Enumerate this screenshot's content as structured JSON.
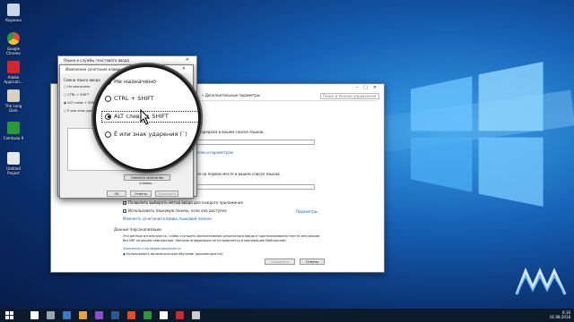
{
  "desktop": {
    "icons": [
      {
        "label": "Корзина",
        "color": "#c9d6e6"
      },
      {
        "label": "Google Chrome",
        "color": "#e8453c"
      },
      {
        "label": "Adobe Applicati...",
        "color": "#d4262c"
      },
      {
        "label": "The Long Dark",
        "color": "#d8d0c0"
      },
      {
        "label": "Camtasia 9",
        "color": "#2a9a3a"
      },
      {
        "label": "Untitled Project",
        "color": "#e8e8e8"
      }
    ]
  },
  "settings_window": {
    "breadcrumb": "« Дополнительные параметры",
    "search_placeholder": "Поиск в панели управления",
    "text1": "...ных интерфейса, которые определен порядком в вашем списке языков.",
    "dropdown1": "...екомендуется)",
    "link1": "...ку просто привязанных учетным записям и параметрам",
    "text2": "...вашем порядке, который находится не на первом месте в вашем списке языков.",
    "dropdown2": "...екомендуется)",
    "checkbox1": "Позволить выбирать метод ввода для каждого приложения",
    "checkbox2": "Использовать языковую панель, если она доступна",
    "link_params": "Параметры",
    "link_hotkeys": "Изменить сочетания клавиш языковой панели",
    "section_personal": "Данные персонализации",
    "personal_text": "Эти данные используются, чтобы улучшить распознавание рукописного ввода и прогнозирования текста для языков без IME на вашем компьютере. Никакая информация не отправляется в корпорацию Майкрософт.",
    "privacy_link": "Заявление о конфиденциальности",
    "auto_learn": "Использовать автоматическое обучение (рекомендуется)",
    "save_button": "Сохранить",
    "cancel_button": "Отмена"
  },
  "lang_dialog": {
    "title": "Языки и службы текстового ввода",
    "inner_title": "Изменение сочетания клавиш",
    "group_label": "Смена языка ввода",
    "options": [
      "Не назначено",
      "CTRL + SHIFT",
      "ALT слева + SHIFT",
      "Ё или знак ударения (`)"
    ],
    "right_group_label": "Смена раскладки клавиатуры",
    "change_hotkey_button": "Сменить сочетание клавиш...",
    "ok_button": "OK",
    "cancel_button": "Отмена",
    "apply_button": "Применить"
  },
  "magnifier": {
    "options": [
      "Не назначено",
      "CTRL + SHIFT",
      "ALT слева + SHIFT",
      "Ё или знак ударения (`)"
    ],
    "selected_index": 2
  },
  "taskbar": {
    "time": "6:16",
    "date": "01.08.2018",
    "icon_colors": [
      "#ffffff",
      "#9aa4b0",
      "#3a78c8",
      "#e6a23c",
      "#8a4fd0",
      "#2b5797",
      "#e34c26",
      "#2a9a3a",
      "#ffffff",
      "#d4262c",
      "#cccccc"
    ]
  },
  "colors": {
    "accent": "#1a5fb4",
    "desktop": "#1662b8"
  }
}
